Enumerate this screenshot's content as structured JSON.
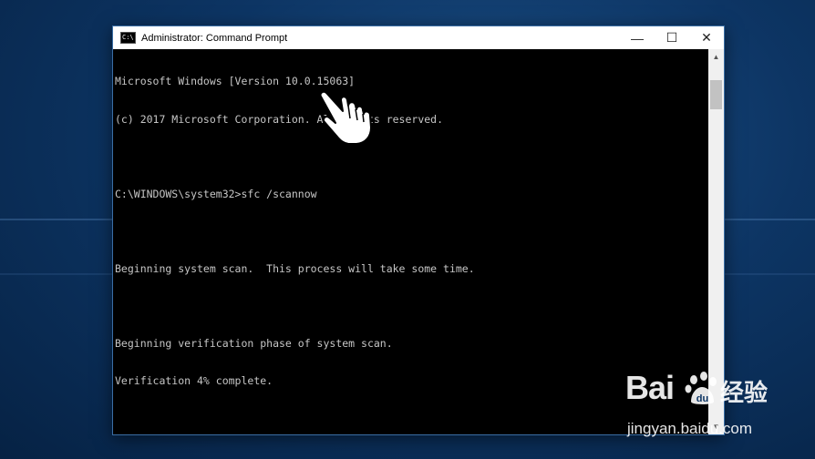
{
  "window": {
    "title": "Administrator: Command Prompt",
    "icon": "cmd-icon",
    "controls": {
      "minimize": "—",
      "maximize": "☐",
      "close": "✕"
    }
  },
  "console": {
    "lines": [
      "Microsoft Windows [Version 10.0.15063]",
      "(c) 2017 Microsoft Corporation. All rights reserved.",
      "",
      "C:\\WINDOWS\\system32>sfc /scannow",
      "",
      "Beginning system scan.  This process will take some time.",
      "",
      "Beginning verification phase of system scan.",
      "Verification 4% complete."
    ]
  },
  "watermark": {
    "brand": "Bai",
    "brand_cn": "经验",
    "url": "jingyan.baidu.com"
  },
  "colors": {
    "console_bg": "#000000",
    "console_text": "#c6c6c6",
    "titlebar_bg": "#ffffff",
    "desktop": "#0d3564"
  }
}
